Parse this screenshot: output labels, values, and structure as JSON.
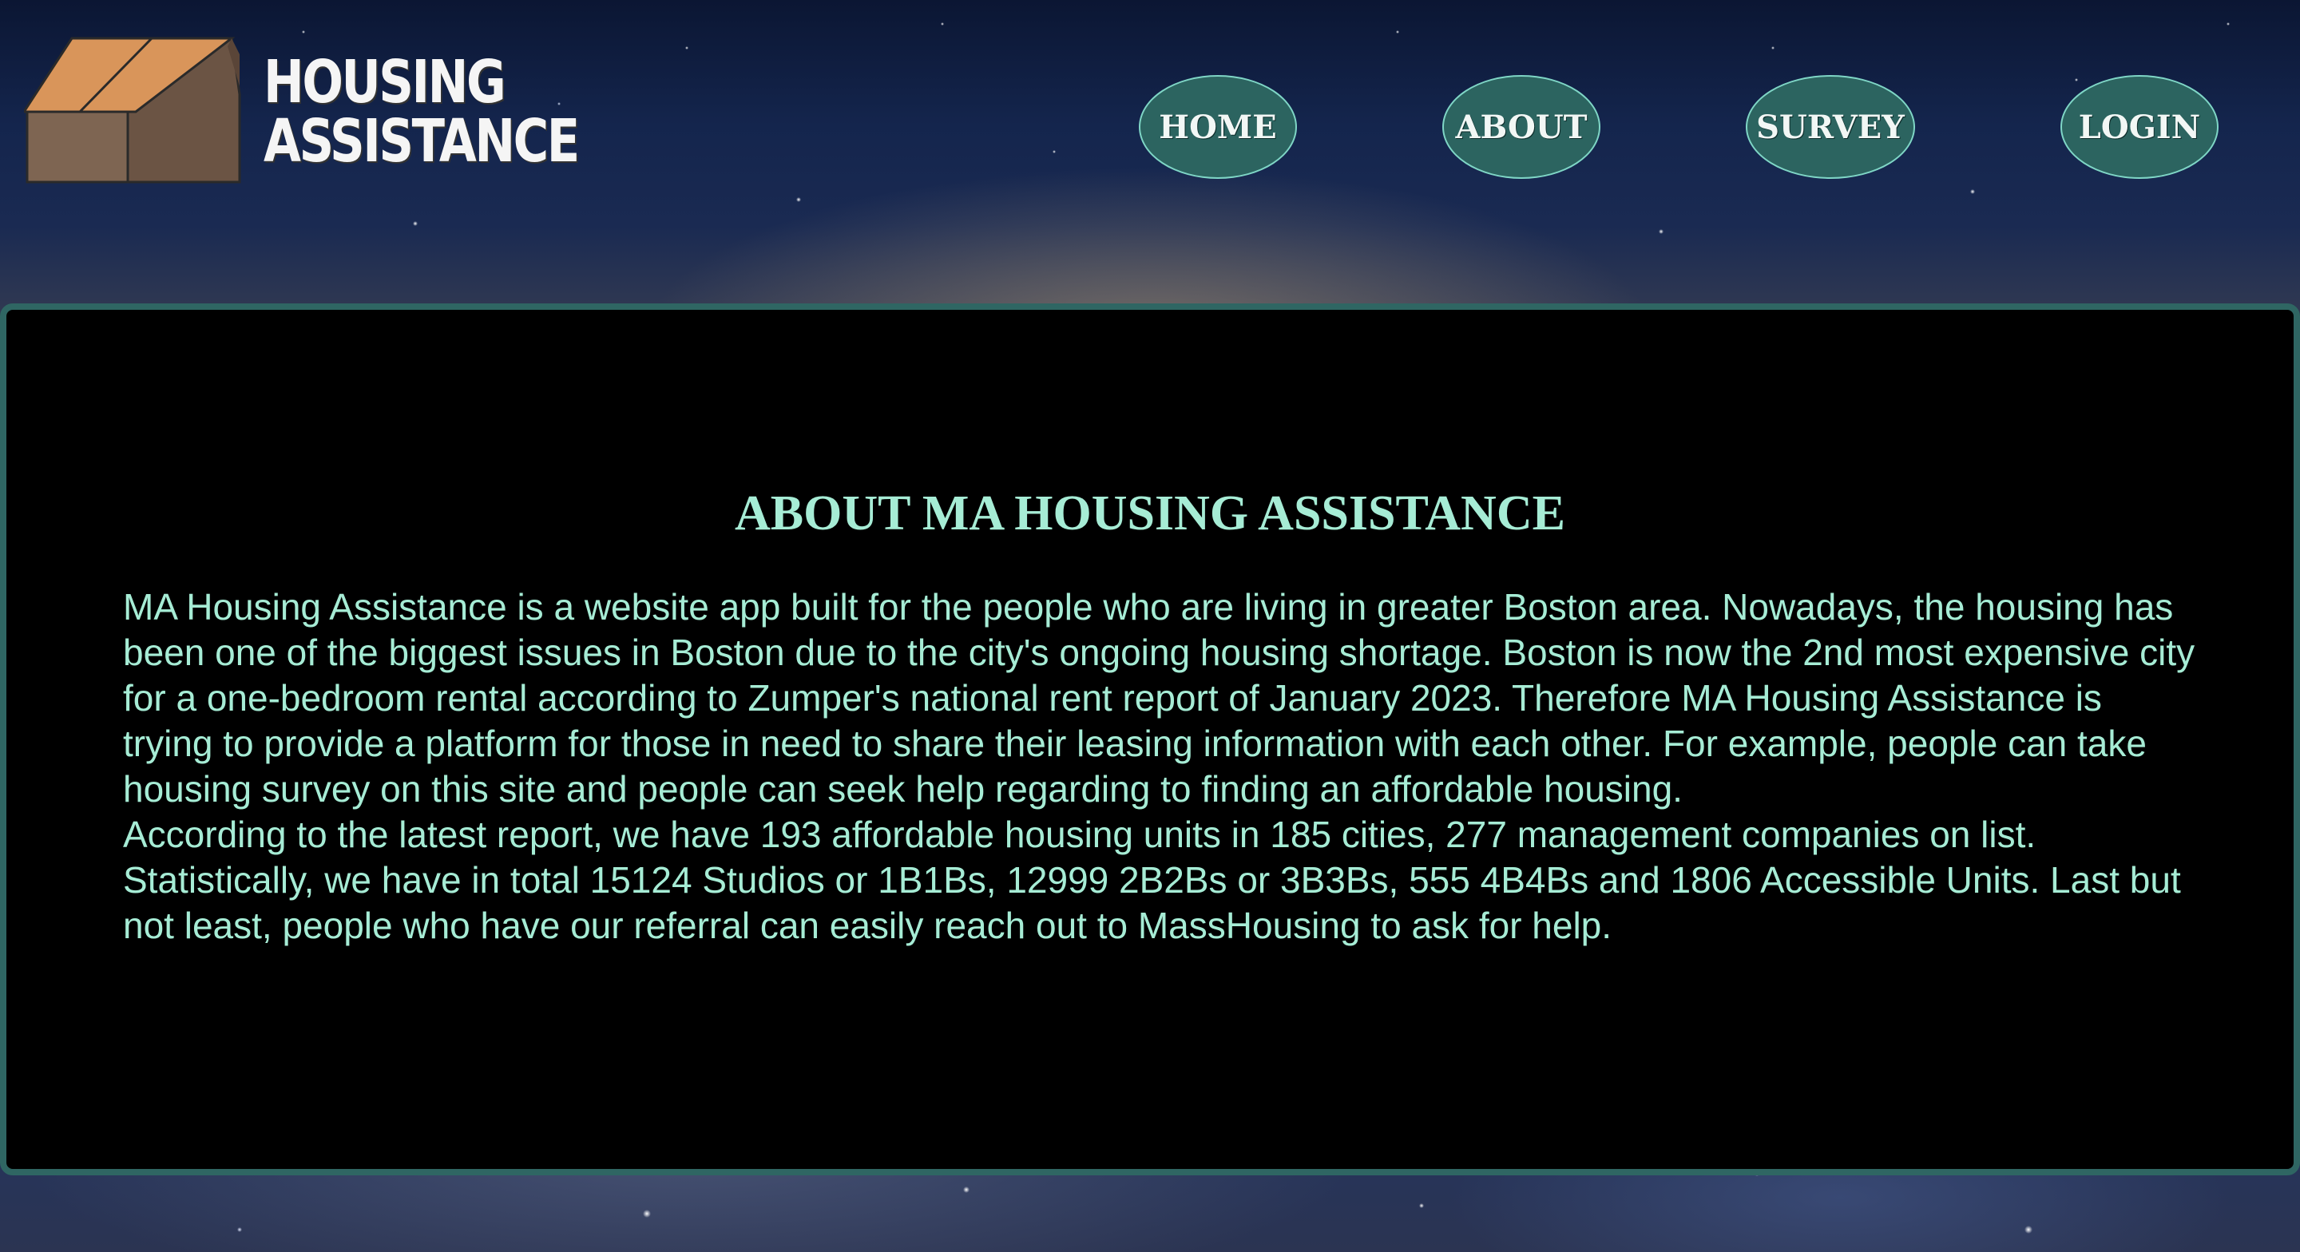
{
  "header": {
    "logo": {
      "line1": "HOUSING",
      "line2": "ASSISTANCE",
      "colors": {
        "roof": "#d9955a",
        "wall_front": "#7e6552",
        "wall_side": "#6b5444",
        "outline": "#2a2a2a"
      }
    }
  },
  "nav": {
    "items": [
      {
        "label": "HOME"
      },
      {
        "label": "ABOUT"
      },
      {
        "label": "SURVEY"
      },
      {
        "label": "LOGIN"
      }
    ]
  },
  "about": {
    "title": "ABOUT MA HOUSING ASSISTANCE",
    "paragraph1": "MA Housing Assistance is a website app built for the people who are living in greater Boston area. Nowadays, the housing has been one of the biggest issues in Boston due to the city's ongoing housing shortage. Boston is now the 2nd most expensive city for a one-bedroom rental according to Zumper's national rent report of January 2023. Therefore MA Housing Assistance is trying to provide a platform for those in need to share their leasing information with each other. For example, people can take housing survey on this site and people can seek help regarding to finding an affordable housing.",
    "paragraph2": "According to the latest report, we have 193 affordable housing units in 185 cities, 277 management companies on list. Statistically, we have in total 15124 Studios or 1B1Bs, 12999 2B2Bs or 3B3Bs, 555 4B4Bs and 1806 Accessible Units. Last but not least, people who have our referral can easily reach out to MassHousing to ask for help."
  },
  "colors": {
    "accent_text": "#a6ecd5",
    "nav_fill": "#2c6460",
    "nav_border": "#7fd6c6",
    "panel_border": "#2f6663"
  }
}
